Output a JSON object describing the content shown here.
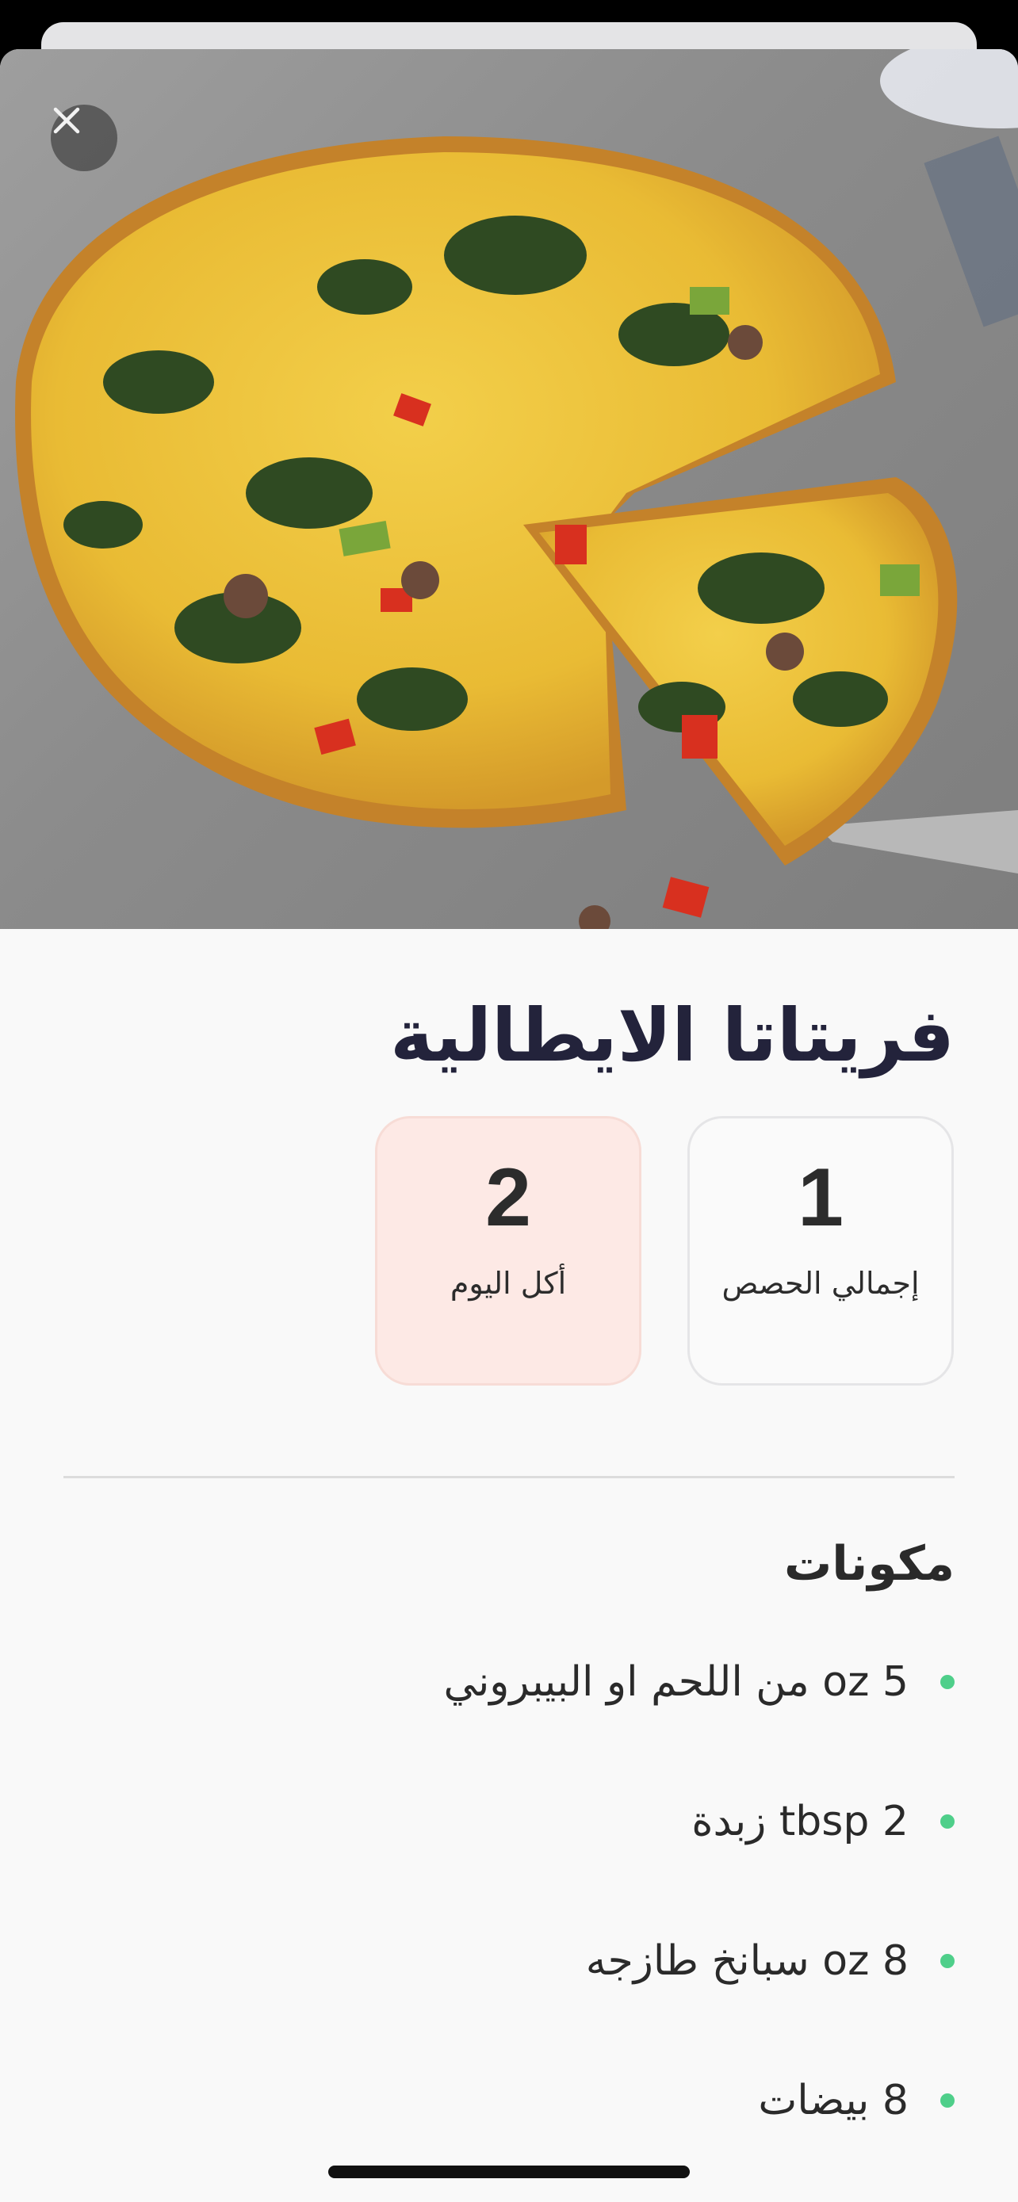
{
  "recipe": {
    "title": "فريتاتا الايطالية",
    "image_alt": "frittata photo"
  },
  "stats": {
    "total_value": "1",
    "total_label": "إجمالي الحصص",
    "today_value": "2",
    "today_label": "أكل اليوم"
  },
  "ingredients": {
    "title": "مكونات",
    "items": [
      "5 oz من اللحم او البيبروني",
      "2 tbsp زبدة",
      "8 oz سبانخ طازجه",
      "8 بيضات"
    ]
  },
  "colors": {
    "accent_bullet": "#4fcf8a",
    "today_card_bg": "#fde9e5",
    "title_color": "#23233b"
  },
  "icons": {
    "close": "close-icon"
  }
}
